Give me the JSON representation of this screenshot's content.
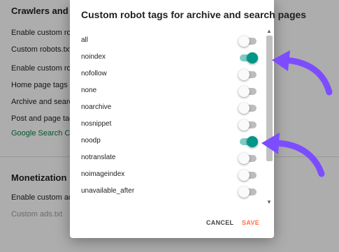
{
  "background": {
    "section1_title": "Crawlers and ind",
    "items1": [
      "Enable custom robo",
      "Custom robots.txt",
      "Enable custom robo",
      "Home page tags",
      "Archive and search",
      "Post and page tags"
    ],
    "link_item": "Google Search Cons",
    "section2_title": "Monetization",
    "enable_ads": "Enable custom ads.",
    "ads_txt": "Custom ads.txt"
  },
  "dialog": {
    "title": "Custom robot tags for archive and search pages",
    "tags": [
      {
        "label": "all",
        "on": false
      },
      {
        "label": "noindex",
        "on": true
      },
      {
        "label": "nofollow",
        "on": false
      },
      {
        "label": "none",
        "on": false
      },
      {
        "label": "noarchive",
        "on": false
      },
      {
        "label": "nosnippet",
        "on": false
      },
      {
        "label": "noodp",
        "on": true
      },
      {
        "label": "notranslate",
        "on": false
      },
      {
        "label": "noimageindex",
        "on": false
      },
      {
        "label": "unavailable_after",
        "on": false
      }
    ],
    "cancel_label": "CANCEL",
    "save_label": "SAVE"
  },
  "colors": {
    "toggle_on": "#009688",
    "toggle_on_track": "#80cbc4",
    "save": "#ff7043",
    "annotation_arrow": "#7c4dff"
  },
  "icons": [
    "chevron-up-icon",
    "chevron-down-icon",
    "curved-arrow-icon"
  ]
}
